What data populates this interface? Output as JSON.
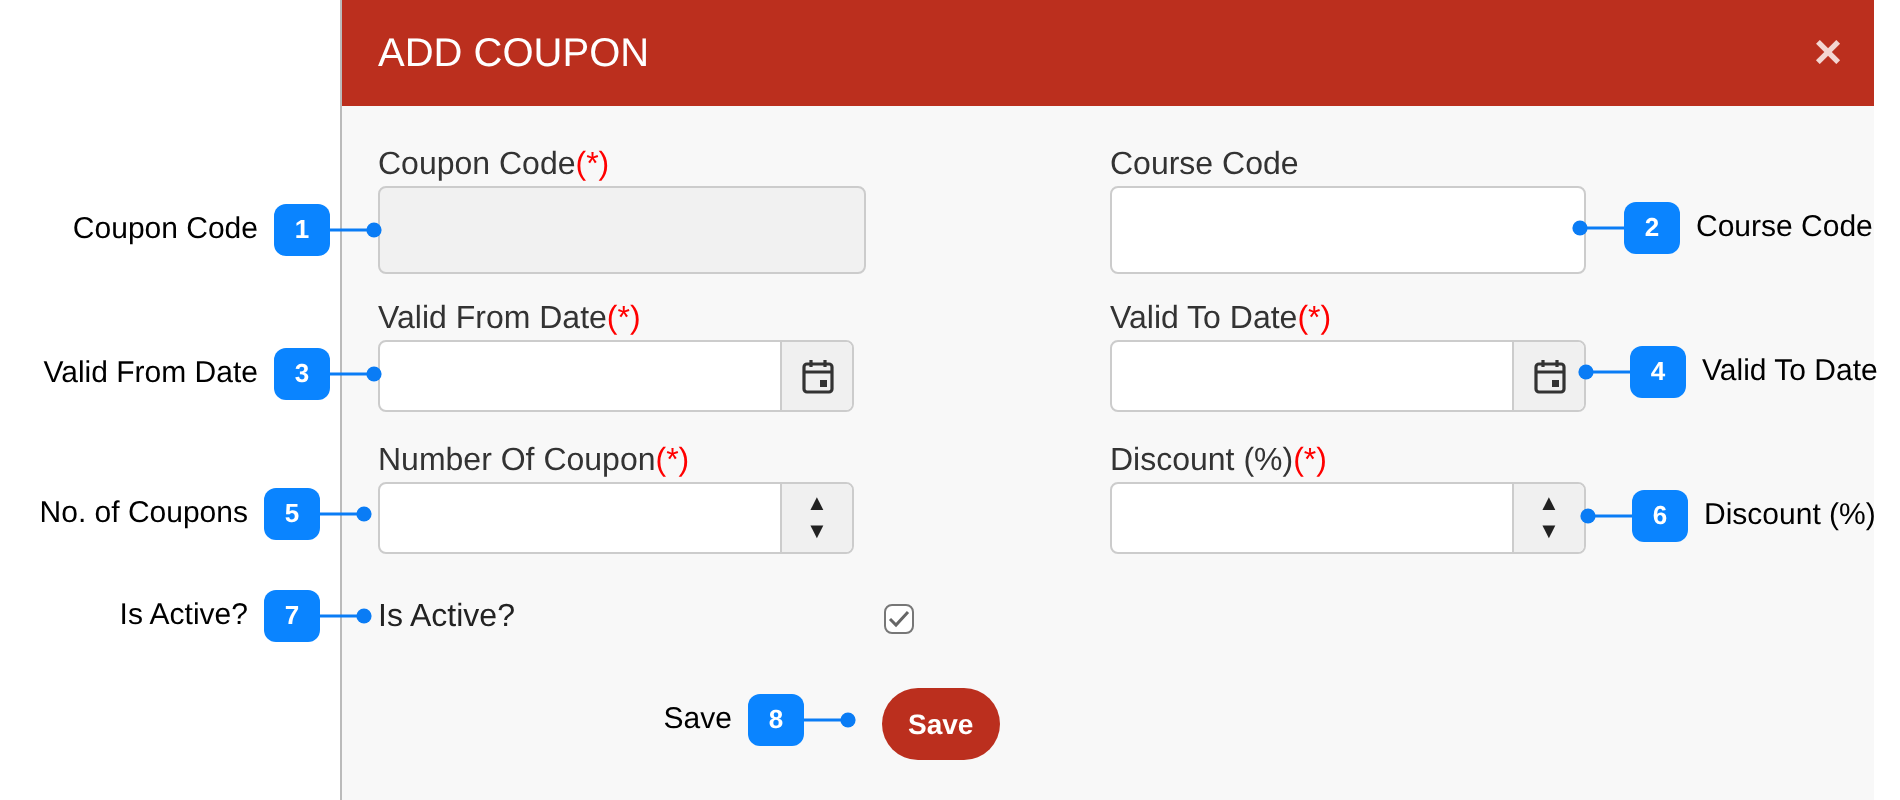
{
  "dialog": {
    "title": "ADD COUPON",
    "close": "×"
  },
  "fields": [
    {
      "label": "Coupon Code",
      "required": "(*)",
      "kind": "text",
      "disabled": true
    },
    {
      "label": "Course Code",
      "kind": "text",
      "disabled": false
    },
    {
      "label": "Valid From Date",
      "required": "(*)",
      "kind": "date",
      "disabled": false
    },
    {
      "label": "Valid To Date",
      "required": "(*)",
      "kind": "date",
      "disabled": false
    },
    {
      "label": "Number Of Coupon",
      "required": "(*)",
      "kind": "number",
      "disabled": false,
      "up": "▲",
      "down": "▼"
    },
    {
      "label": "Discount (%)",
      "required": "(*)",
      "kind": "number",
      "disabled": false,
      "up": "▲",
      "down": "▼"
    }
  ],
  "active": {
    "label": "Is Active?",
    "checked": true
  },
  "save_button": "Save",
  "callouts": [
    {
      "number": "1",
      "label": "Coupon Code"
    },
    {
      "number": "2",
      "label": "Course Code"
    },
    {
      "number": "3",
      "label": "Valid From Date"
    },
    {
      "number": "4",
      "label": "Valid To Date"
    },
    {
      "number": "5",
      "label": "No. of Coupons"
    },
    {
      "number": "6",
      "label": "Discount (%)"
    },
    {
      "number": "7",
      "label": "Is Active?"
    },
    {
      "number": "8",
      "label": "Save"
    }
  ]
}
